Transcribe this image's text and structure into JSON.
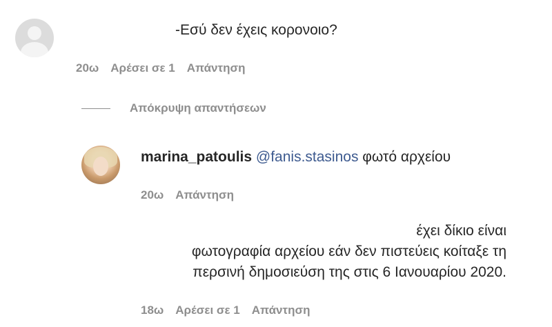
{
  "comment1": {
    "text": "-Εσύ δεν έχεις κορονοιο?",
    "time": "20ω",
    "likes": "Αρέσει σε 1",
    "reply": "Απάντηση"
  },
  "toggle": {
    "label": "Απόκρυψη απαντήσεων"
  },
  "reply1": {
    "username": "marina_patoulis",
    "mention": "@fanis.stasinos",
    "text": " φωτό αρχείου",
    "time": "20ω",
    "reply": "Απάντηση"
  },
  "reply2": {
    "line1": "έχει δίκιο είναι",
    "line2": "φωτογραφία αρχείου εάν δεν πιστεύεις κοίταξε τη",
    "line3": "περσινή δημοσιεύση της στις 6 Ιανουαρίου 2020.",
    "time": "18ω",
    "likes": "Αρέσει σε 1",
    "reply": "Απάντηση"
  }
}
